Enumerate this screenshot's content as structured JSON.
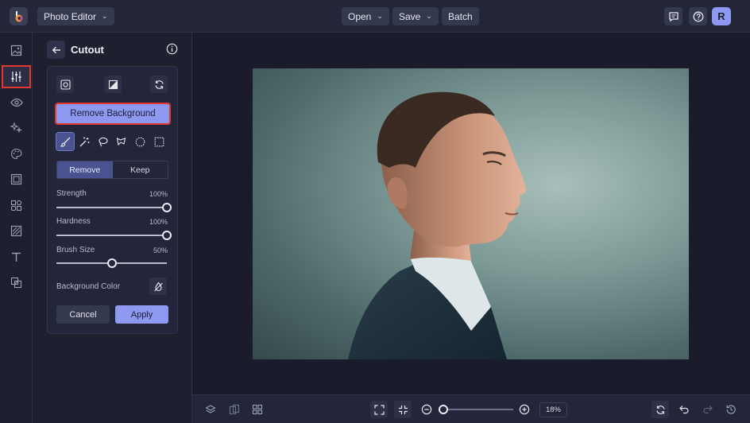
{
  "topbar": {
    "app_menu_label": "Photo Editor",
    "open_label": "Open",
    "save_label": "Save",
    "batch_label": "Batch",
    "avatar_initial": "R"
  },
  "rail": {
    "items": [
      "image-icon",
      "sliders-icon",
      "eye-icon",
      "sparkles-icon",
      "palette-icon",
      "frame-icon",
      "shapes-icon",
      "texture-icon",
      "text-icon",
      "overlay-icon"
    ],
    "active_index": 1
  },
  "panel": {
    "title": "Cutout",
    "remove_background_label": "Remove Background",
    "mode": {
      "remove_label": "Remove",
      "keep_label": "Keep",
      "selected": "Remove"
    },
    "strength": {
      "label": "Strength",
      "value_text": "100%",
      "value": 100
    },
    "hardness": {
      "label": "Hardness",
      "value_text": "100%",
      "value": 100
    },
    "brush_size": {
      "label": "Brush Size",
      "value_text": "50%",
      "value": 50
    },
    "background_color_label": "Background Color",
    "cancel_label": "Cancel",
    "apply_label": "Apply"
  },
  "zoom": {
    "value_text": "18%",
    "value": 18
  },
  "colors": {
    "accent": "#8d98f0",
    "highlight": "#e3382f",
    "background": "#1e2030"
  }
}
